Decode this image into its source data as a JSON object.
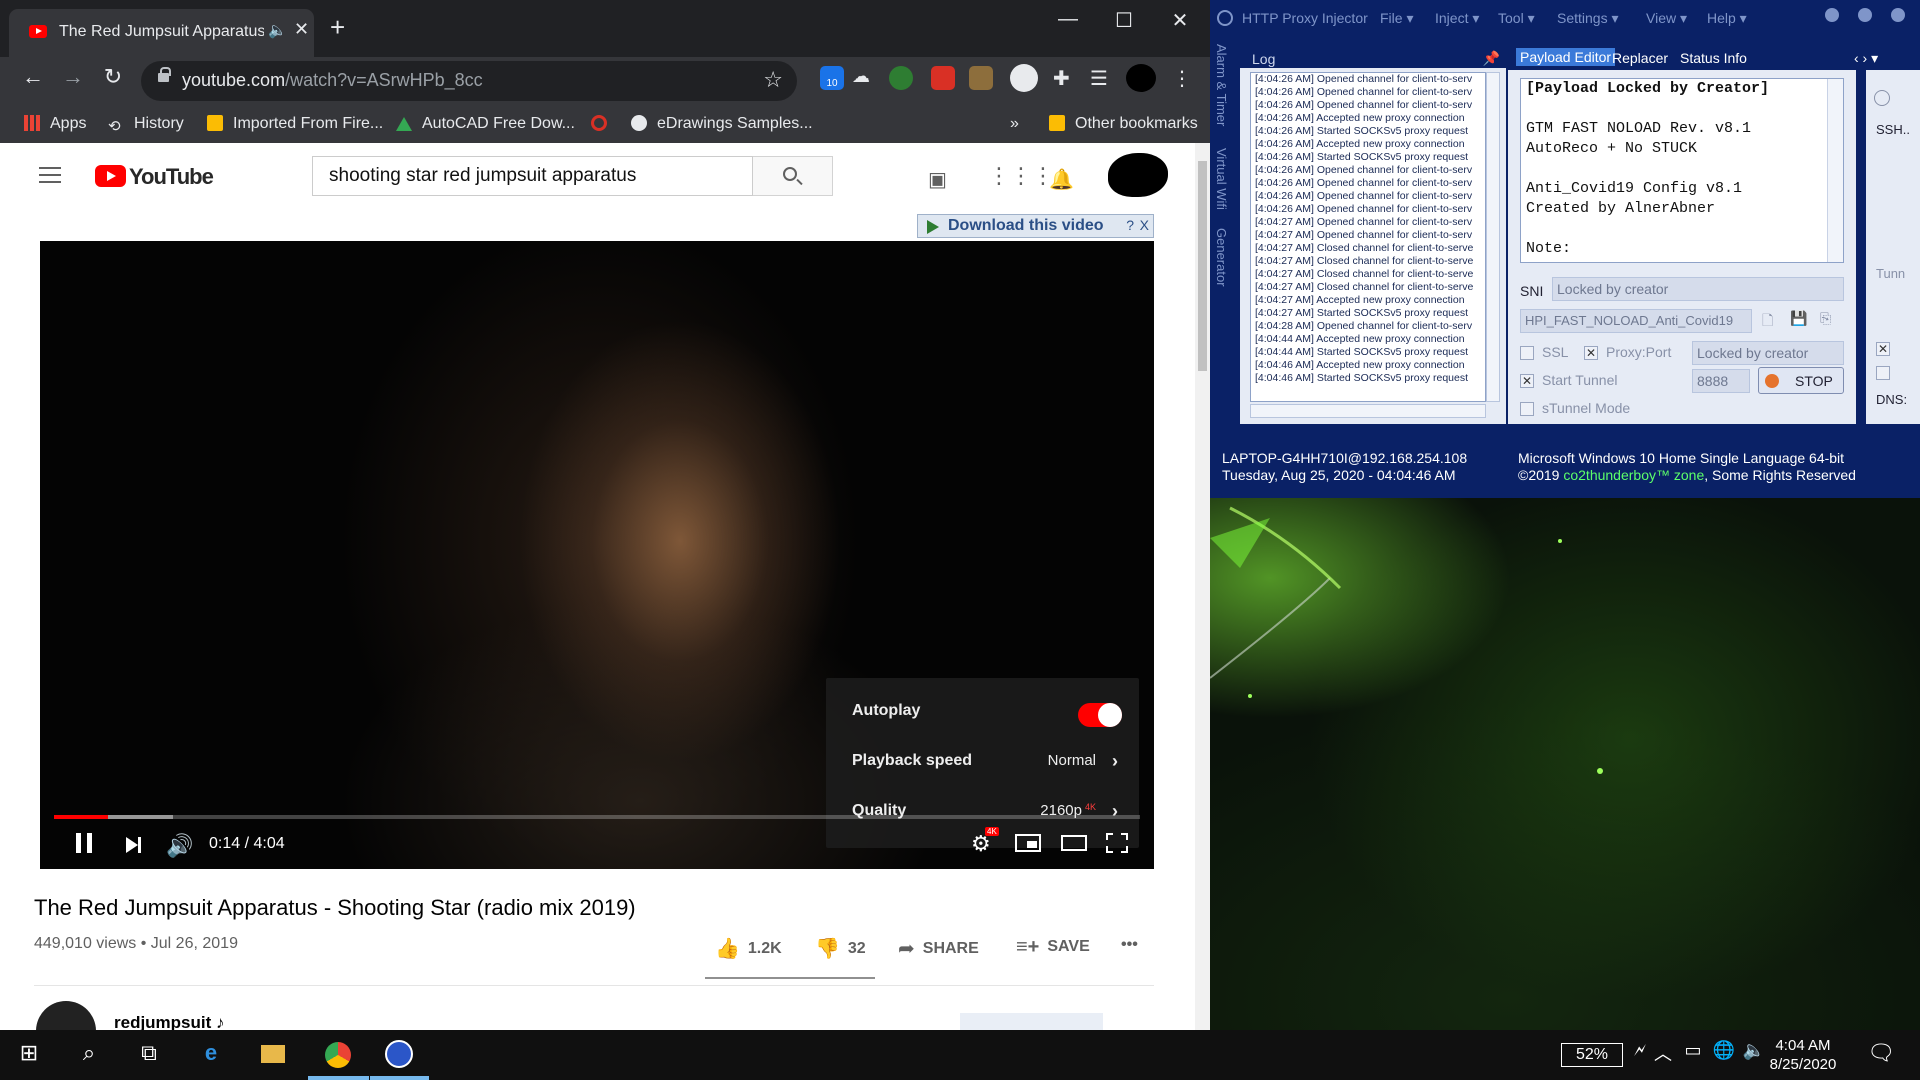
{
  "browser": {
    "tab_title": "The Red Jumpsuit Apparatus",
    "new_tab": "+",
    "url_host": "youtube.com",
    "url_path": "/watch?v=ASrwHPb_8cc",
    "bookmarks": [
      {
        "label": "Apps"
      },
      {
        "label": "History"
      },
      {
        "label": "Imported From Fire..."
      },
      {
        "label": "AutoCAD Free Dow..."
      },
      {
        "label": "eDrawings Samples..."
      },
      {
        "label": "»"
      },
      {
        "label": "Other bookmarks"
      }
    ],
    "ext_badge": "10"
  },
  "youtube": {
    "logo": "YouTube",
    "search_value": "shooting star red jumpsuit apparatus",
    "download_label": "Download this video",
    "download_help": "?",
    "download_close": "X",
    "settings": {
      "autoplay_label": "Autoplay",
      "autoplay_on": true,
      "speed_label": "Playback speed",
      "speed_value": "Normal",
      "quality_label": "Quality",
      "quality_value": "2160p",
      "quality_badge": "4K"
    },
    "player": {
      "time": "0:14 / 4:04",
      "played_fraction": 0.05,
      "buffered_fraction": 0.11,
      "gear_badge": "4K"
    },
    "video_title": "The Red Jumpsuit Apparatus - Shooting Star (radio mix 2019)",
    "views_date": "449,010 views • Jul 26, 2019",
    "likes": "1.2K",
    "dislikes": "32",
    "share_label": "SHARE",
    "save_label": "SAVE",
    "more_label": "•••",
    "channel_name": "redjumpsuit ♪"
  },
  "hpi": {
    "title": "HTTP Proxy Injector",
    "menu": [
      "File ▾",
      "Inject ▾",
      "Tool ▾",
      "Settings ▾",
      "View ▾",
      "Help ▾"
    ],
    "side_tabs": [
      "Alarm & Timer",
      "Virtual Wifi",
      "Generator"
    ],
    "log_label": "Log",
    "log_lines": [
      "[4:04:26 AM] Opened channel for client-to-serv",
      "[4:04:26 AM] Opened channel for client-to-serv",
      "[4:04:26 AM] Opened channel for client-to-serv",
      "[4:04:26 AM] Accepted new proxy connection",
      "[4:04:26 AM] Started SOCKSv5 proxy request",
      "[4:04:26 AM] Accepted new proxy connection",
      "[4:04:26 AM] Started SOCKSv5 proxy request",
      "[4:04:26 AM] Opened channel for client-to-serv",
      "[4:04:26 AM] Opened channel for client-to-serv",
      "[4:04:26 AM] Opened channel for client-to-serv",
      "[4:04:26 AM] Opened channel for client-to-serv",
      "[4:04:27 AM] Opened channel for client-to-serv",
      "[4:04:27 AM] Opened channel for client-to-serv",
      "[4:04:27 AM] Closed channel for client-to-serve",
      "[4:04:27 AM] Closed channel for client-to-serve",
      "[4:04:27 AM] Closed channel for client-to-serve",
      "[4:04:27 AM] Closed channel for client-to-serve",
      "[4:04:27 AM] Accepted new proxy connection",
      "[4:04:27 AM] Started SOCKSv5 proxy request",
      "[4:04:28 AM] Opened channel for client-to-serv",
      "[4:04:44 AM] Accepted new proxy connection",
      "[4:04:44 AM] Started SOCKSv5 proxy request",
      "[4:04:46 AM] Accepted new proxy connection",
      "[4:04:46 AM] Started SOCKSv5 proxy request"
    ],
    "tabs": [
      "Payload Editor",
      "Replacer",
      "Status Info"
    ],
    "payload_lines": [
      "[Payload Locked by Creator]",
      "",
      "GTM FAST NOLOAD Rev. v8.1",
      "AutoReco + No STUCK",
      "",
      "Anti_Covid19 Config v8.1",
      "Created by AlnerAbner",
      "",
      "Note:"
    ],
    "sni_label": "SNI",
    "sni_value": "Locked by creator",
    "profile_value": "HPI_FAST_NOLOAD_Anti_Covid19",
    "ssl_label": "SSL",
    "proxy_port_label": "Proxy:Port",
    "proxy_value": "Locked by creator",
    "start_tunnel_label": "Start Tunnel",
    "port_value": "8888",
    "stop_label": "STOP",
    "stunnel_label": "sTunnel Mode",
    "right_labels": [
      "SSH..",
      "Tunn",
      "DNS:"
    ],
    "status_host": "LAPTOP-G4HH710I@192.168.254.108",
    "status_date": "Tuesday, Aug 25, 2020 - 04:04:46 AM",
    "status_os": "Microsoft Windows 10 Home Single Language 64-bit",
    "status_copy_pre": "©2019 ",
    "status_copy_link": "co2thunderboy™ zone",
    "status_copy_post": ", Some Rights Reserved"
  },
  "taskbar": {
    "battery": "52%",
    "time": "4:04 AM",
    "date": "8/25/2020"
  },
  "colors": {
    "youtube_red": "#ff0000",
    "hpi_blue": "#0a2166",
    "hpi_tab_active": "#3b7ad9",
    "link_green": "#5cff6a"
  }
}
